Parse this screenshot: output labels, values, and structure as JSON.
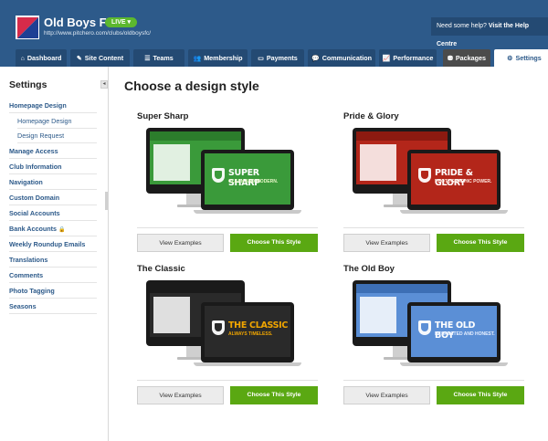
{
  "header": {
    "club_name": "Old Boys FC",
    "live_label": "LIVE ▾",
    "club_url": "http://www.pitchero.com/clubs/oldboysfc/",
    "help_prefix": "Need some help?",
    "help_link": "Visit the Help Centre"
  },
  "tabs": [
    {
      "label": "Dashboard",
      "icon": "home-icon",
      "glyph": "⌂"
    },
    {
      "label": "Site Content",
      "icon": "pencil-icon",
      "glyph": "✎"
    },
    {
      "label": "Teams",
      "icon": "list-icon",
      "glyph": "☰"
    },
    {
      "label": "Membership",
      "icon": "users-icon",
      "glyph": "👥"
    },
    {
      "label": "Payments",
      "icon": "card-icon",
      "glyph": "▭"
    },
    {
      "label": "Communication",
      "icon": "chat-icon",
      "glyph": "💬"
    },
    {
      "label": "Performance",
      "icon": "chart-icon",
      "glyph": "📈"
    },
    {
      "label": "Packages",
      "icon": "package-icon",
      "glyph": "⛃"
    },
    {
      "label": "Settings",
      "icon": "gear-icon",
      "glyph": "⚙"
    }
  ],
  "sidebar": {
    "heading": "Settings",
    "collapse_glyph": "◂",
    "items": [
      {
        "label": "Homepage Design"
      },
      {
        "label": "Homepage Design"
      },
      {
        "label": "Design Request"
      },
      {
        "label": "Manage Access"
      },
      {
        "label": "Club Information"
      },
      {
        "label": "Navigation"
      },
      {
        "label": "Custom Domain"
      },
      {
        "label": "Social Accounts"
      },
      {
        "label": "Bank Accounts"
      },
      {
        "label": "Weekly Roundup Emails"
      },
      {
        "label": "Translations"
      },
      {
        "label": "Comments"
      },
      {
        "label": "Photo Tagging"
      },
      {
        "label": "Seasons"
      }
    ],
    "lock_glyph": "🔒"
  },
  "main": {
    "title": "Choose a design style",
    "examples_label": "View Examples",
    "choose_label": "Choose This Style",
    "styles": [
      {
        "name": "Super Sharp",
        "screen_title": "SUPER SHARP",
        "screen_sub": "CLEAN AND MODERN.",
        "bg": "#3a9a3a",
        "accent": "#ffffff",
        "head": "#2c7d2c",
        "sub_color": "#e8f8c8"
      },
      {
        "name": "Pride & Glory",
        "screen_title": "PRIDE & GLORY",
        "screen_sub": "PHOTOGRAPHIC POWER.",
        "bg": "#b3261a",
        "accent": "#ffffff",
        "head": "#8c1a10",
        "sub_color": "#ffe8e0"
      },
      {
        "name": "The Classic",
        "screen_title": "THE CLASSIC",
        "screen_sub": "ALWAYS TIMELESS.",
        "bg": "#2a2a2a",
        "accent": "#f0a500",
        "head": "#1a1a1a",
        "sub_color": "#f0a500"
      },
      {
        "name": "The Old Boy",
        "screen_title": "THE OLD BOY",
        "screen_sub": "RESPECTED AND HONEST.",
        "bg": "#5b8fd6",
        "accent": "#ffffff",
        "head": "#3d6fb5",
        "sub_color": "#e8f0ff"
      }
    ]
  }
}
